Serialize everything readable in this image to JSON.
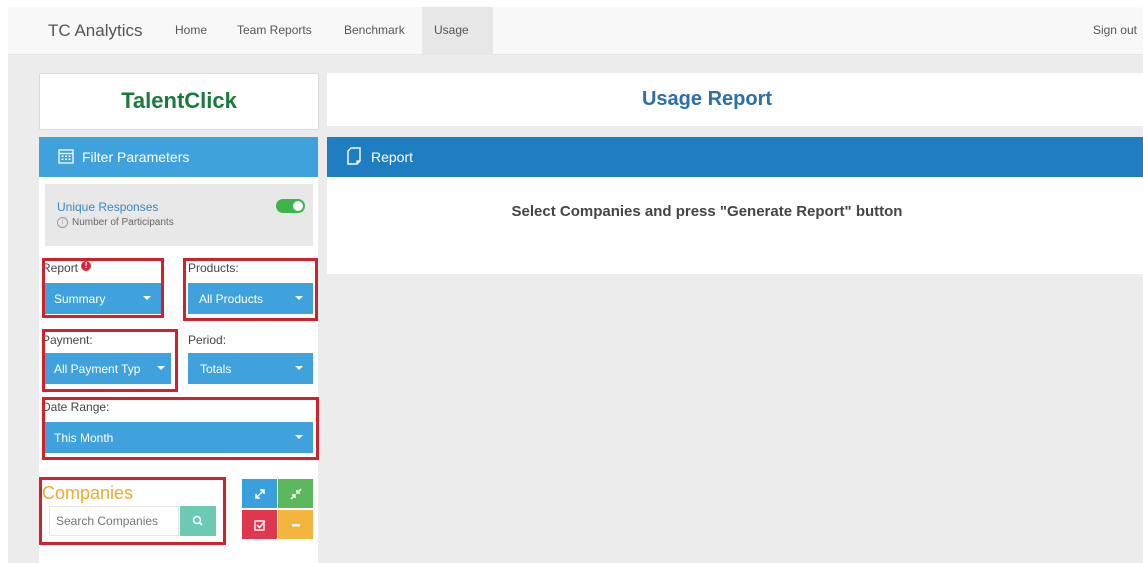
{
  "nav": {
    "brand": "TC Analytics",
    "items": [
      "Home",
      "Team Reports",
      "Benchmark",
      "Usage"
    ],
    "active": "Usage",
    "sign_out": "Sign out"
  },
  "sidebar": {
    "brand_title": "TalentClick",
    "filter_header": "Filter Parameters",
    "unique_responses": {
      "title": "Unique Responses",
      "subtitle": "Number of Participants",
      "enabled": true
    },
    "report": {
      "label": "Report",
      "value": "Summary"
    },
    "products": {
      "label": "Products:",
      "value": "All Products"
    },
    "payment": {
      "label": "Payment:",
      "value": "All Payment Typ"
    },
    "period": {
      "label": "Period:",
      "value": "Totals"
    },
    "date_range": {
      "label": "Date Range:",
      "value": "This Month"
    },
    "companies": {
      "title": "Companies",
      "search_placeholder": "Search Companies"
    }
  },
  "main": {
    "title": "Usage Report",
    "report_header": "Report",
    "message": "Select Companies and press \"Generate Report\" button"
  },
  "colors": {
    "brand_green": "#197a3a",
    "header_blue": "#3fa2dd",
    "report_blue": "#1f7dc1",
    "companies_orange": "#f0a830",
    "annotation_red": "#d4202b"
  }
}
